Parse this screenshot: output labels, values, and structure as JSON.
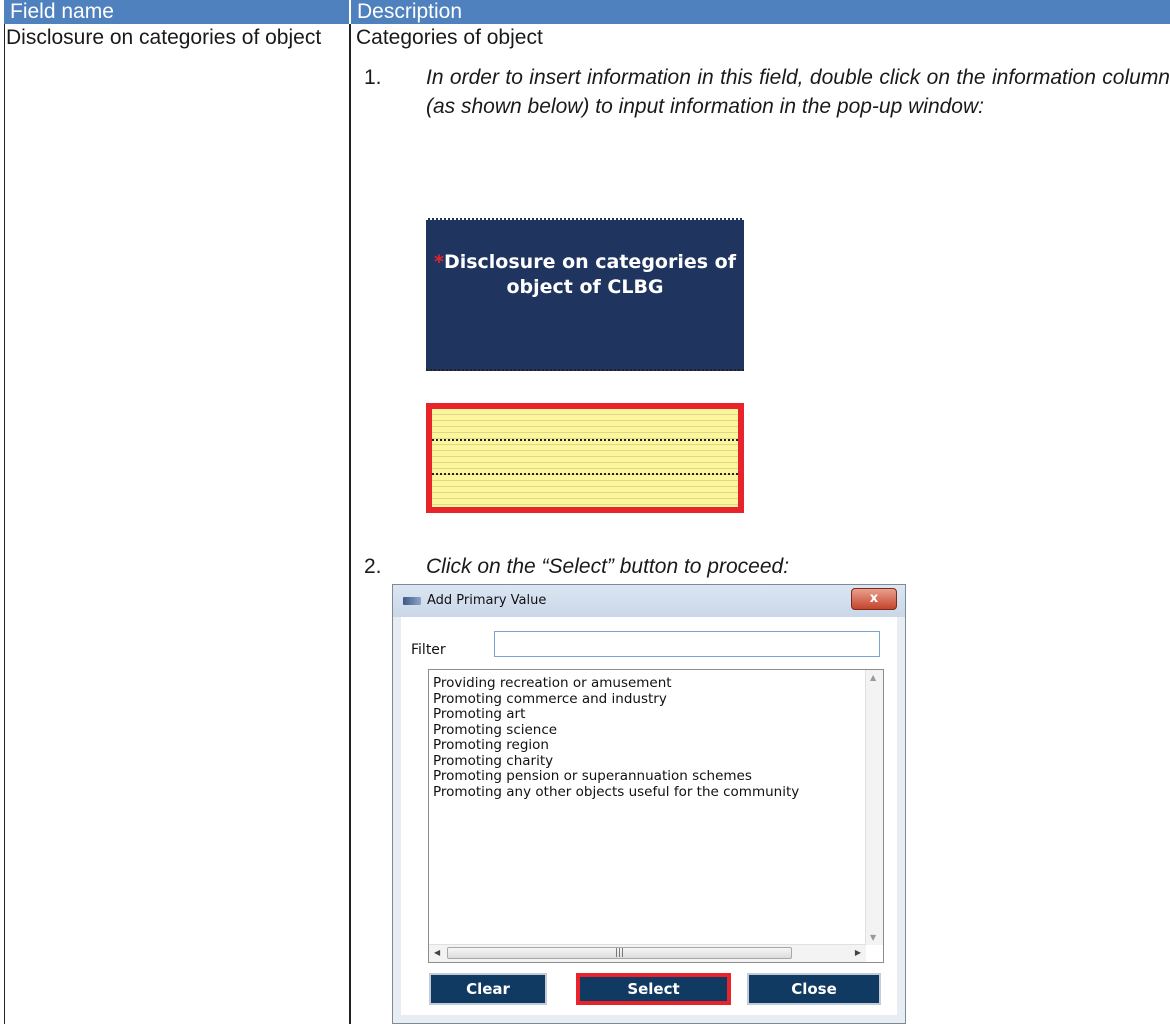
{
  "table": {
    "header": {
      "field_name": "Field name",
      "description": "Description"
    },
    "row": {
      "field_name": "Disclosure on categories of object",
      "category_title": "Categories of object",
      "steps": [
        {
          "number": "1.",
          "text": "In order to insert information in this field, double click on the information column (as shown below) to input information in the pop-up window:"
        },
        {
          "number": "2.",
          "text": "Click on the “Select” button to proceed:"
        }
      ]
    }
  },
  "field_box": {
    "required_marker": "*",
    "label": "Disclosure on categories of object of CLBG"
  },
  "dialog": {
    "title": "Add Primary Value",
    "close_glyph": "x",
    "filter_label": "Filter",
    "filter_value": "",
    "options": [
      "Providing recreation or amusement",
      "Promoting commerce and industry",
      "Promoting art",
      "Promoting science",
      "Promoting region",
      "Promoting charity",
      "Promoting pension or superannuation schemes",
      "Promoting any other objects useful for the community"
    ],
    "buttons": {
      "clear": "Clear",
      "select": "Select",
      "close": "Close"
    }
  },
  "colors": {
    "header_bg": "#4e81bd",
    "field_box_bg": "#1f3560",
    "highlight_red": "#e8232a",
    "input_yellow": "#fbf59c",
    "dialog_button_bg": "#113a63"
  }
}
